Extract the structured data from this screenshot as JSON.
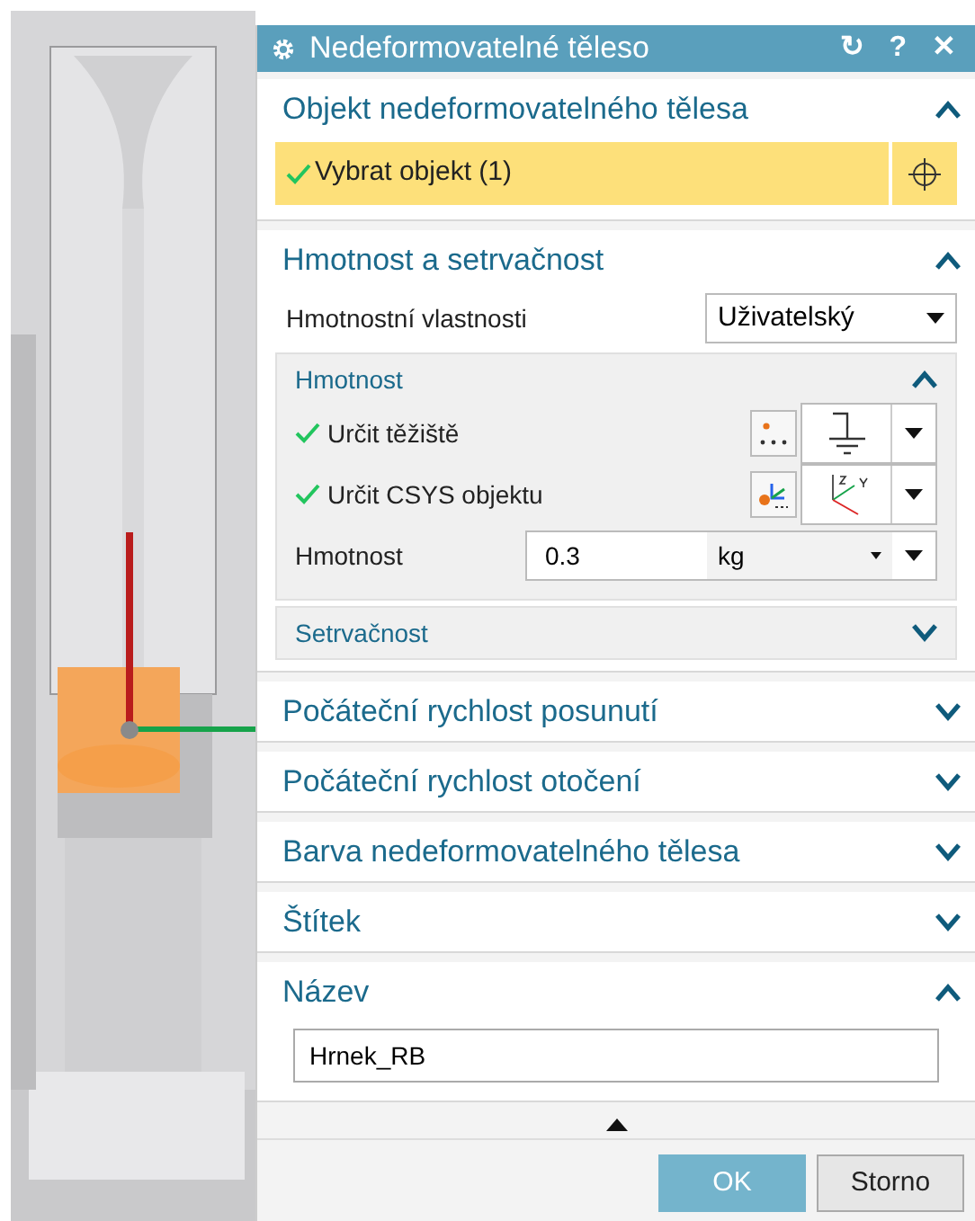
{
  "dialog": {
    "title": "Nedeformovatelné těleso",
    "title_icons": [
      "↻",
      "?",
      "✕"
    ]
  },
  "sections": [
    {
      "kind": "select",
      "title": "Objekt nedeformovatelného tělesa",
      "expanded": true,
      "select_row": {
        "label": "Vybrat objekt (1)",
        "done": true
      }
    },
    {
      "kind": "mass",
      "title": "Hmotnost a setrvačnost",
      "expanded": true,
      "property": {
        "label": "Hmotnostní vlastnosti",
        "value": "Uživatelský"
      },
      "subgroups": [
        {
          "title": "Hmotnost",
          "expanded": true,
          "rows": [
            {
              "kind": "point",
              "label": "Určit těžiště",
              "done": true
            },
            {
              "kind": "csys",
              "label": "Určit CSYS objektu",
              "done": true
            },
            {
              "kind": "value",
              "label": "Hmotnost",
              "value": "0.3",
              "unit": "kg"
            }
          ]
        },
        {
          "title": "Setrvačnost",
          "expanded": false
        }
      ]
    },
    {
      "title": "Počáteční rychlost posunutí",
      "expanded": false
    },
    {
      "title": "Počáteční rychlost otočení",
      "expanded": false
    },
    {
      "title": "Barva nedeformovatelného tělesa",
      "expanded": false
    },
    {
      "title": "Štítek",
      "expanded": false
    },
    {
      "kind": "name",
      "title": "Název",
      "expanded": true,
      "value": "Hrnek_RB"
    }
  ],
  "buttons": [
    {
      "label": "OK",
      "primary": true
    },
    {
      "label": "Storno",
      "primary": false
    }
  ]
}
